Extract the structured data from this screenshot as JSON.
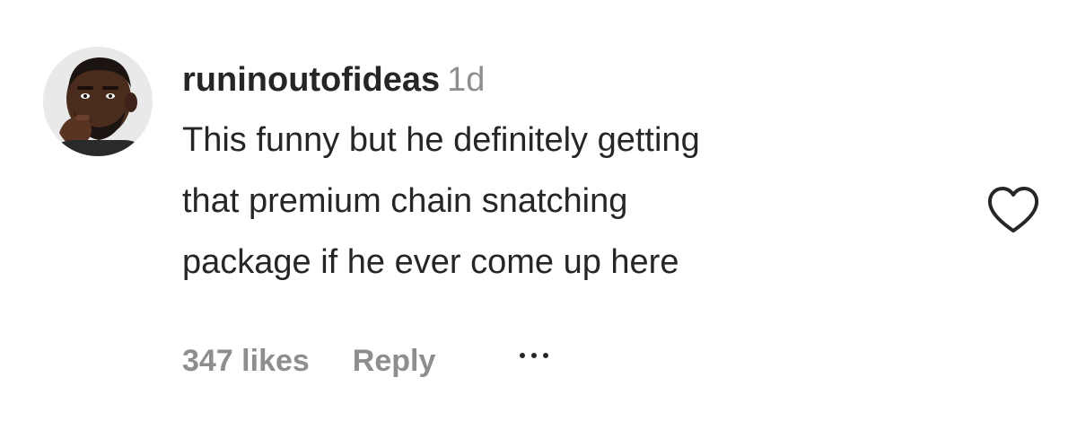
{
  "comment": {
    "username": "runinoutofideas",
    "timestamp": "1d",
    "text_lines": [
      "This funny but he definitely getting",
      "that premium chain snatching",
      "package if he ever come up here"
    ],
    "likes": "347 likes",
    "reply_label": "Reply",
    "avatar_icon": "user-avatar",
    "like_icon": "heart-outline-icon",
    "more_icon": "ellipsis-icon"
  },
  "colors": {
    "text_primary": "#262626",
    "text_secondary": "#8e8e8e",
    "avatar_background": "#e9e9ea"
  }
}
